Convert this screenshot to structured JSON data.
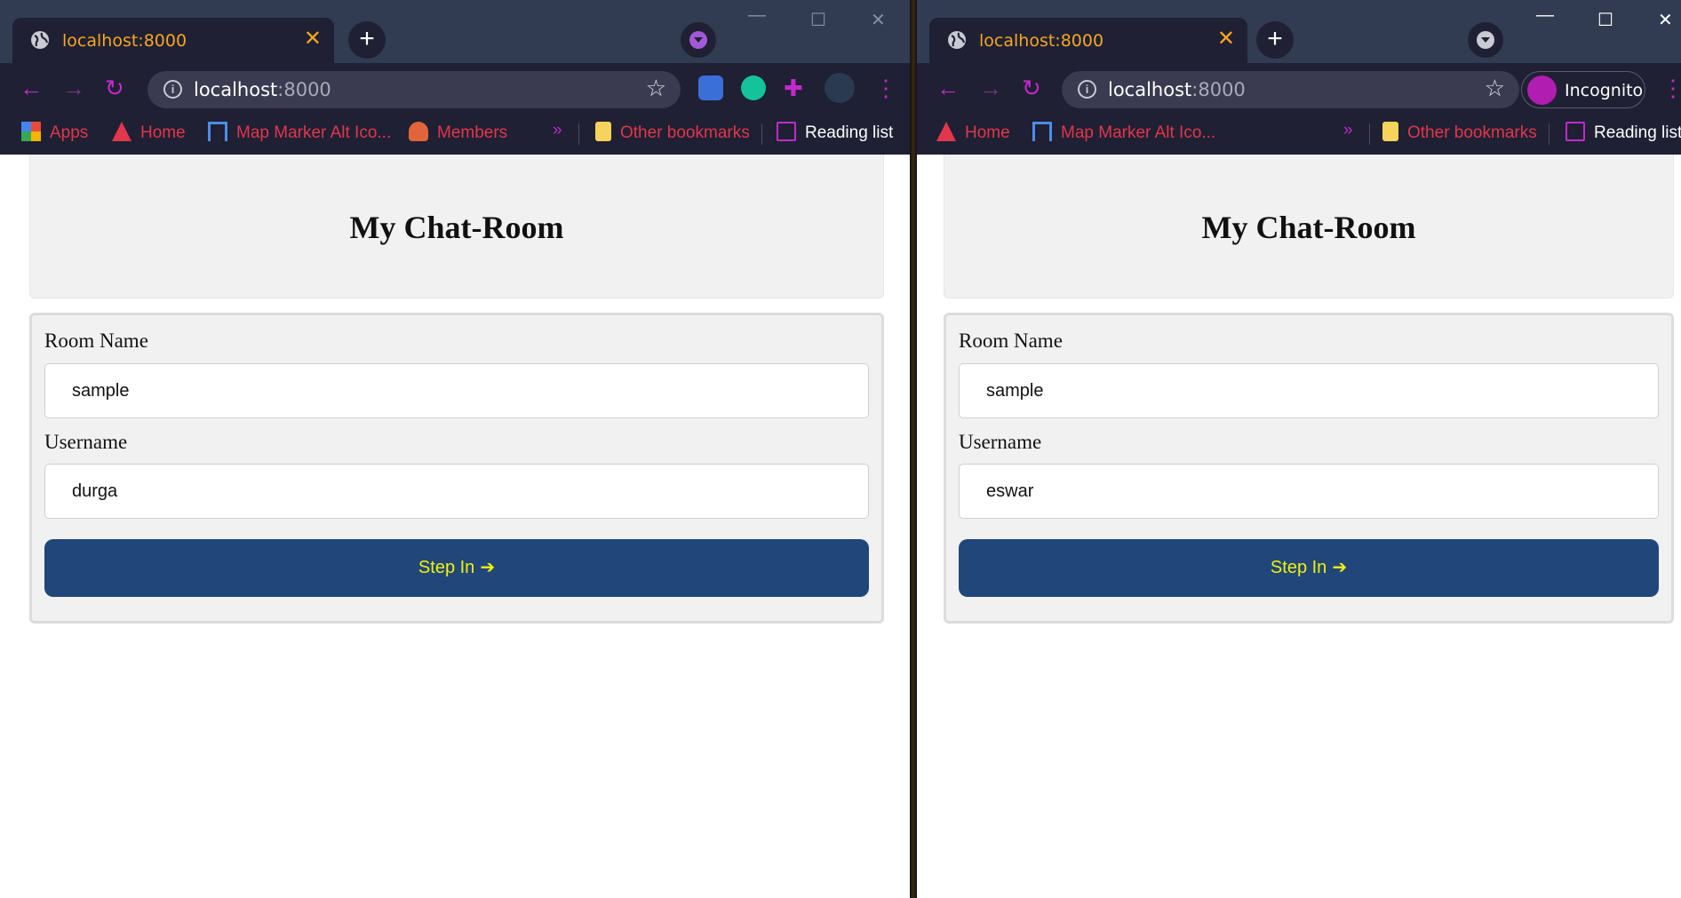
{
  "left": {
    "tab_title": "localhost:8000",
    "url_host": "localhost",
    "url_port": ":8000",
    "bookmarks": [
      "Apps",
      "Home",
      "Map Marker Alt Ico...",
      "Members",
      "»",
      "Other bookmarks",
      "Reading list"
    ],
    "page_title": "My Chat-Room",
    "room_label": "Room Name",
    "room_value": "sample",
    "user_label": "Username",
    "user_value": "durga",
    "button_label": "Step In"
  },
  "right": {
    "tab_title": "localhost:8000",
    "url_host": "localhost",
    "url_port": ":8000",
    "incognito_label": "Incognito",
    "bookmarks": [
      "Home",
      "Map Marker Alt Ico...",
      "»",
      "Other bookmarks",
      "Reading list"
    ],
    "page_title": "My Chat-Room",
    "room_label": "Room Name",
    "room_value": "sample",
    "user_label": "Username",
    "user_value": "eswar",
    "button_label": "Step In"
  },
  "colors": {
    "tab_accent": "#f6a623",
    "bookmark_text": "#e2364c",
    "button_bg": "#21467a",
    "button_text": "#f1f20a",
    "nav_icons": "#c22acb"
  },
  "icons": [
    "globe-icon",
    "close-icon",
    "plus-icon",
    "tab-search-icon",
    "back-icon",
    "forward-icon",
    "reload-icon",
    "info-icon",
    "star-icon",
    "translate-icon",
    "grammarly-icon",
    "extensions-icon",
    "profile-icon",
    "menu-icon",
    "apps-icon",
    "home-icon",
    "flag-icon",
    "members-icon",
    "folder-icon",
    "reading-list-icon",
    "sign-in-icon",
    "incognito-icon"
  ]
}
